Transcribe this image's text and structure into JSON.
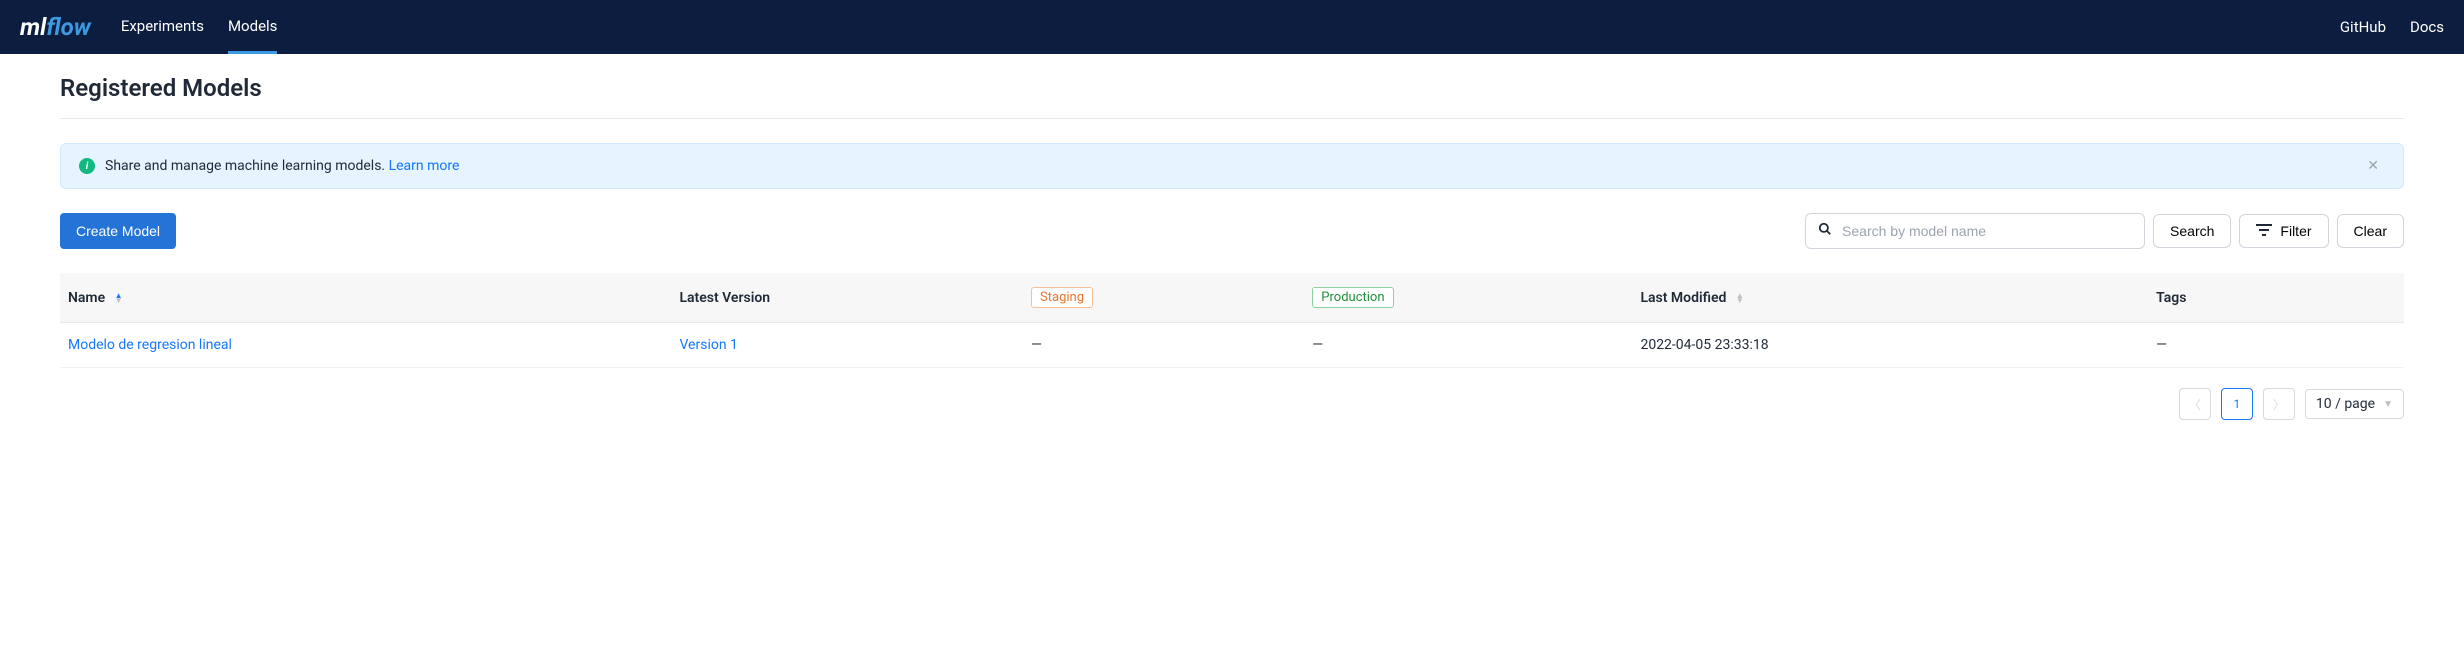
{
  "header": {
    "nav": {
      "experiments": "Experiments",
      "models": "Models"
    },
    "links": {
      "github": "GitHub",
      "docs": "Docs"
    }
  },
  "page": {
    "title": "Registered Models"
  },
  "banner": {
    "text": "Share and manage machine learning models. ",
    "link": "Learn more"
  },
  "toolbar": {
    "create": "Create Model",
    "search_placeholder": "Search by model name",
    "search": "Search",
    "filter": "Filter",
    "clear": "Clear"
  },
  "table": {
    "headers": {
      "name": "Name",
      "latest": "Latest Version",
      "staging": "Staging",
      "production": "Production",
      "last_modified": "Last Modified",
      "tags": "Tags"
    },
    "rows": [
      {
        "name": "Modelo de regresion lineal",
        "latest": "Version 1",
        "staging": "—",
        "production": "—",
        "last_modified": "2022-04-05 23:33:18",
        "tags": "—"
      }
    ]
  },
  "pagination": {
    "page": "1",
    "size": "10 / page"
  }
}
